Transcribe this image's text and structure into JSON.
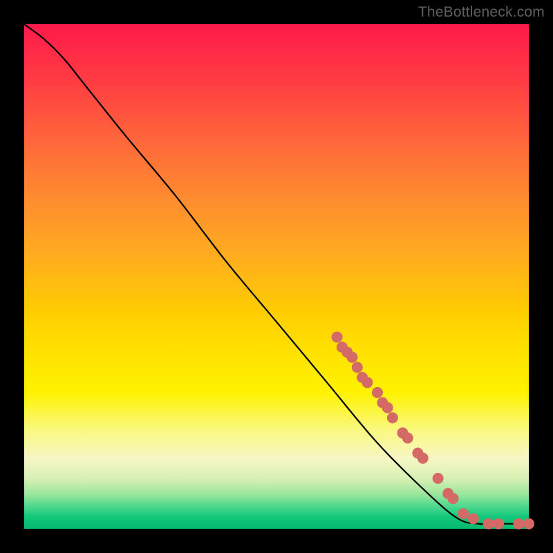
{
  "attribution": "TheBottleneck.com",
  "colors": {
    "marker": "#d46a65",
    "line": "#000000"
  },
  "chart_data": {
    "type": "line",
    "title": "",
    "xlabel": "",
    "ylabel": "",
    "xlim": [
      0,
      100
    ],
    "ylim": [
      0,
      100
    ],
    "grid": false,
    "legend": false,
    "series": [
      {
        "name": "curve",
        "style": "line",
        "points": [
          {
            "x": 0,
            "y": 100
          },
          {
            "x": 4,
            "y": 97
          },
          {
            "x": 8,
            "y": 93
          },
          {
            "x": 12,
            "y": 88
          },
          {
            "x": 20,
            "y": 78
          },
          {
            "x": 30,
            "y": 66
          },
          {
            "x": 40,
            "y": 53
          },
          {
            "x": 50,
            "y": 41
          },
          {
            "x": 60,
            "y": 29
          },
          {
            "x": 70,
            "y": 17
          },
          {
            "x": 80,
            "y": 7
          },
          {
            "x": 86,
            "y": 2
          },
          {
            "x": 90,
            "y": 1
          },
          {
            "x": 95,
            "y": 1
          },
          {
            "x": 100,
            "y": 1
          }
        ]
      },
      {
        "name": "markers",
        "style": "marker",
        "points": [
          {
            "x": 62,
            "y": 38
          },
          {
            "x": 63,
            "y": 36
          },
          {
            "x": 64,
            "y": 35
          },
          {
            "x": 65,
            "y": 34
          },
          {
            "x": 66,
            "y": 32
          },
          {
            "x": 67,
            "y": 30
          },
          {
            "x": 68,
            "y": 29
          },
          {
            "x": 70,
            "y": 27
          },
          {
            "x": 71,
            "y": 25
          },
          {
            "x": 72,
            "y": 24
          },
          {
            "x": 73,
            "y": 22
          },
          {
            "x": 75,
            "y": 19
          },
          {
            "x": 76,
            "y": 18
          },
          {
            "x": 78,
            "y": 15
          },
          {
            "x": 79,
            "y": 14
          },
          {
            "x": 82,
            "y": 10
          },
          {
            "x": 84,
            "y": 7
          },
          {
            "x": 85,
            "y": 6
          },
          {
            "x": 87,
            "y": 3
          },
          {
            "x": 89,
            "y": 2
          },
          {
            "x": 92,
            "y": 1
          },
          {
            "x": 94,
            "y": 1
          },
          {
            "x": 98,
            "y": 1
          },
          {
            "x": 100,
            "y": 1
          }
        ]
      }
    ]
  }
}
